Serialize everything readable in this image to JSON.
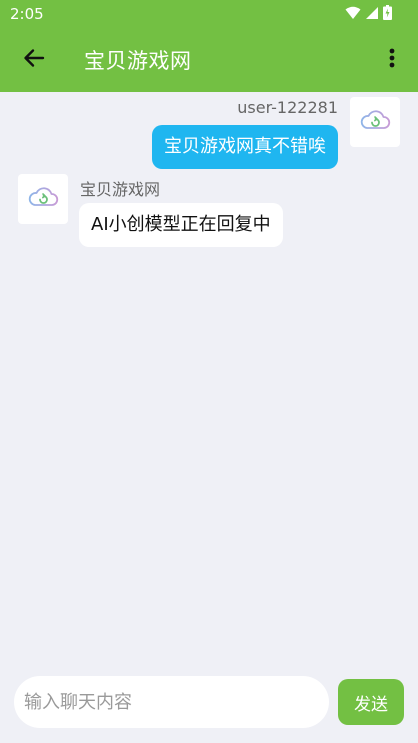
{
  "status_bar": {
    "time": "2:05",
    "icons": [
      "wifi-icon",
      "signal-icon",
      "battery-charging-icon"
    ]
  },
  "app_bar": {
    "title": "宝贝游戏网",
    "back_icon": "arrow-left-icon",
    "menu_icon": "more-vert-icon",
    "background_color": "#73c043"
  },
  "messages": [
    {
      "role": "user",
      "sender": "user-122281",
      "text": "宝贝游戏网真不错唉",
      "avatar_icon": "cloud-refresh-icon",
      "bubble_color": "#1fb6f0"
    },
    {
      "role": "bot",
      "sender": "宝贝游戏网",
      "text": "AI小创模型正在回复中",
      "avatar_icon": "cloud-refresh-icon",
      "bubble_color": "#ffffff"
    }
  ],
  "composer": {
    "placeholder": "输入聊天内容",
    "value": "",
    "send_label": "发送"
  }
}
